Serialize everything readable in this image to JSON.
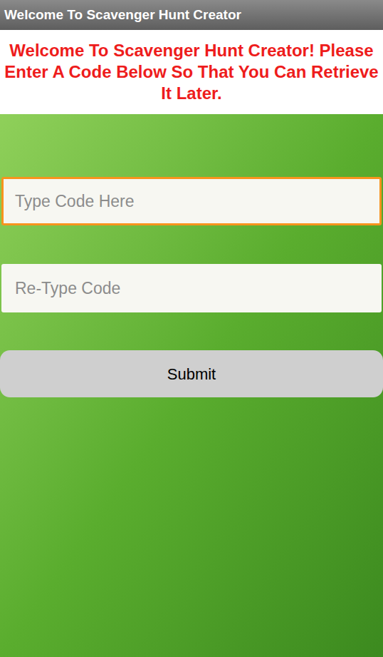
{
  "window": {
    "title": "Welcome To Scavenger Hunt Creator"
  },
  "message": "Welcome To Scavenger Hunt Creator! Please Enter A Code Below So That You Can Retrieve It Later.",
  "fields": [
    {
      "placeholder": "Type Code Here",
      "focused": true
    },
    {
      "placeholder": "Re-Type Code",
      "focused": false
    }
  ],
  "buttons": [
    "Submit"
  ]
}
